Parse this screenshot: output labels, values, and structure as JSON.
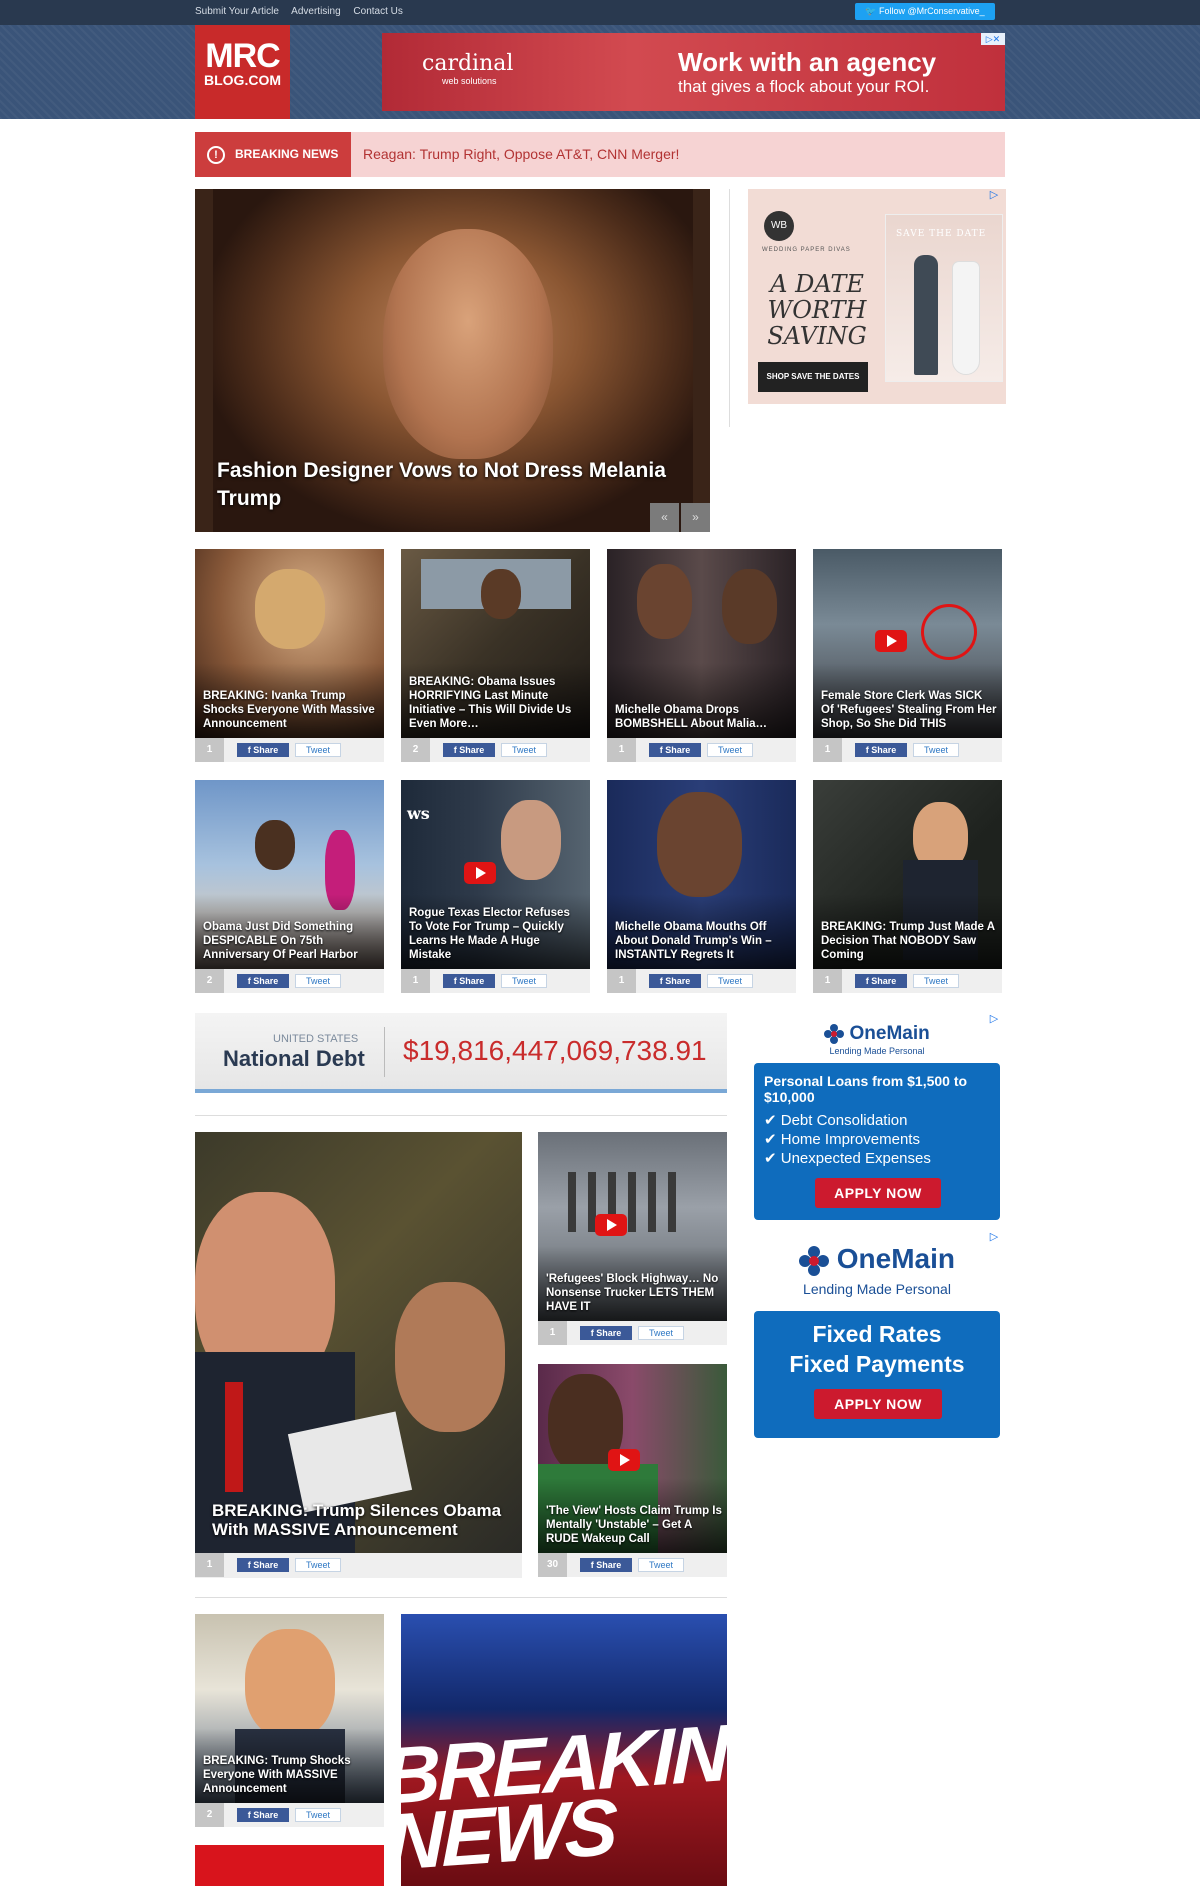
{
  "topbar": {
    "links": [
      "Submit Your Article",
      "Advertising",
      "Contact Us"
    ],
    "follow_label": "Follow @MrConservative_"
  },
  "logo": {
    "line1": "MRC",
    "line2": "BLOG.COM"
  },
  "banner_ad": {
    "brand": "cardinal",
    "brand_sub": "web solutions",
    "headline1": "Work with an agency",
    "headline2": "that gives a flock about your ROI."
  },
  "breaking": {
    "label": "BREAKING NEWS",
    "headline": "Reagan: Trump Right, Oppose AT&T, CNN Merger!"
  },
  "hero": {
    "title": "Fashion Designer Vows to Not Dress Melania Trump",
    "prev": "«",
    "next": "»"
  },
  "side_ad1": {
    "seal": "WB",
    "small": "WEDDING PAPER DIVAS",
    "big": "A DATE WORTH SAVING",
    "button": "SHOP SAVE THE DATES",
    "photo_caption": "SAVE THE DATE"
  },
  "share": {
    "fb": "f  Share",
    "tw": "Tweet"
  },
  "cards_row1": [
    {
      "title": "BREAKING: Ivanka Trump Shocks Everyone With Massive Announcement",
      "count": "1"
    },
    {
      "title": "BREAKING: Obama Issues HORRIFYING Last Minute Initiative – This Will Divide Us Even More…",
      "count": "2"
    },
    {
      "title": "Michelle Obama Drops BOMBSHELL About Malia…",
      "count": "1"
    },
    {
      "title": "Female Store Clerk Was SICK Of 'Refugees' Stealing From Her Shop, So She Did THIS",
      "count": "1"
    }
  ],
  "cards_row2": [
    {
      "title": "Obama Just Did Something DESPICABLE On 75th Anniversary Of Pearl Harbor",
      "count": "2"
    },
    {
      "title": "Rogue Texas Elector Refuses To Vote For Trump – Quickly Learns He Made A Huge Mistake",
      "count": "1"
    },
    {
      "title": "Michelle Obama Mouths Off About Donald Trump's Win – INSTANTLY Regrets It",
      "count": "1"
    },
    {
      "title": "BREAKING: Trump Just Made A Decision That NOBODY Saw Coming",
      "count": "1"
    }
  ],
  "debt": {
    "country": "UNITED STATES",
    "label": "National Debt",
    "value": "$19,816,447,069,738.91"
  },
  "onemain1": {
    "logo": "OneMain",
    "sub": "Lending Made Personal",
    "title": "Personal Loans from $1,500 to $10,000",
    "items": [
      "Debt Consolidation",
      "Home Improvements",
      "Unexpected Expenses"
    ],
    "button": "APPLY NOW"
  },
  "onemain2": {
    "logo": "OneMain",
    "sub": "Lending Made Personal",
    "line1": "Fixed Rates",
    "line2": "Fixed Payments",
    "button": "APPLY NOW"
  },
  "big_story": {
    "title": "BREAKING: Trump Silences Obama With MASSIVE Announcement",
    "count": "1"
  },
  "right_stories": [
    {
      "title": "'Refugees' Block Highway… No Nonsense Trucker LETS THEM HAVE IT",
      "count": "1"
    },
    {
      "title": "'The View' Hosts Claim Trump Is Mentally 'Unstable' – Get A RUDE Wakeup Call",
      "count": "30"
    }
  ],
  "bottom_card": {
    "title": "BREAKING: Trump Shocks Everyone With MASSIVE Announcement",
    "count": "2"
  },
  "breaking_image": {
    "line1": "BREAKIN",
    "line2": "NEWS"
  }
}
